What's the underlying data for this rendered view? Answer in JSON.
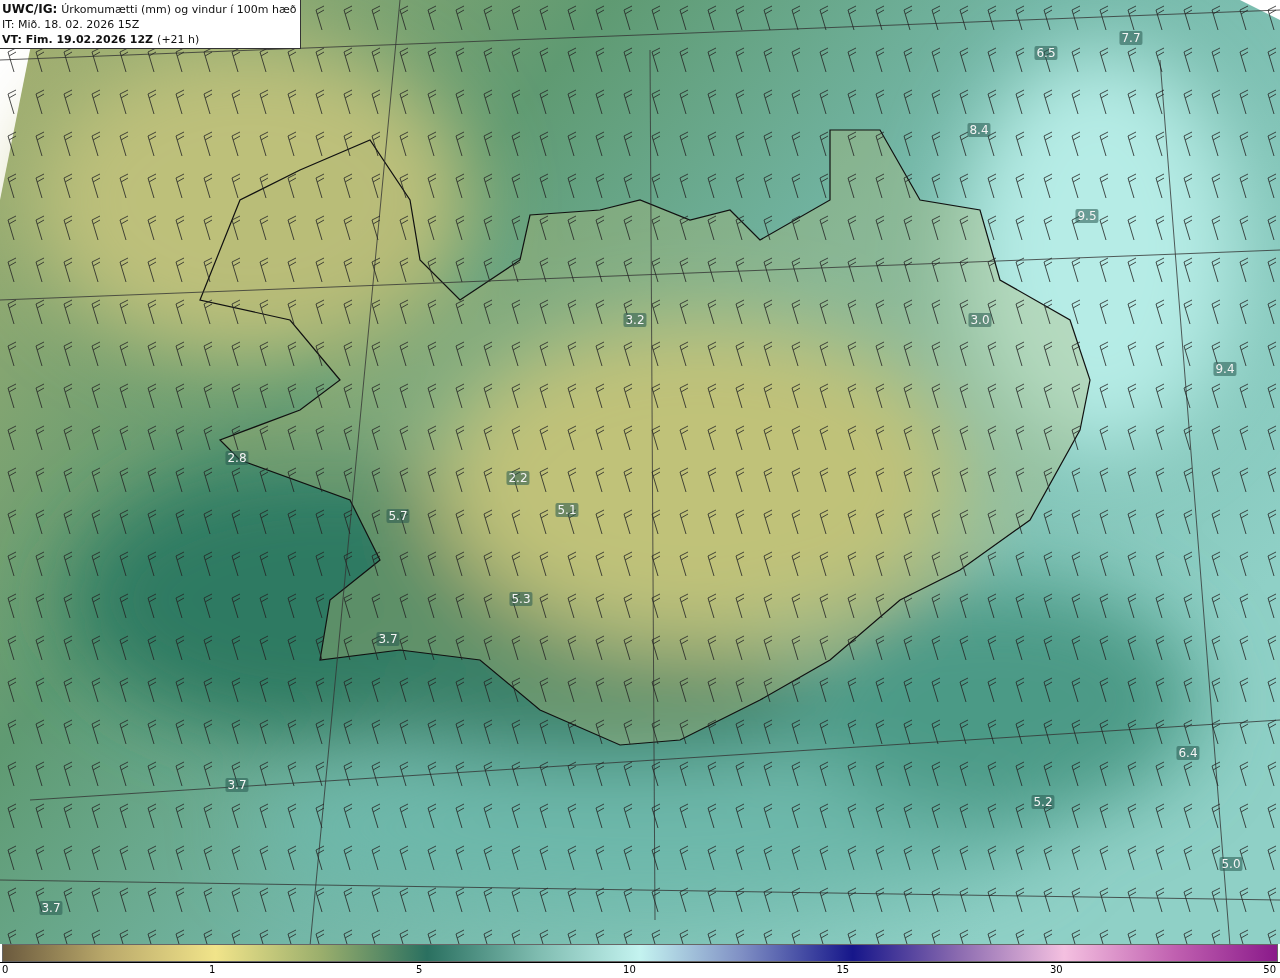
{
  "title_box": {
    "product": "UWC/IG:",
    "description": "Úrkomumætti (mm) og vindur í 100m hæð",
    "issue_time": "IT: Mið. 18. 02. 2026 15Z",
    "valid_label": "VT: Fim. 19.02.2026 12Z",
    "valid_offset": "(+21 h)"
  },
  "map_labels": [
    {
      "text": "6.5"
    },
    {
      "text": "7.7"
    },
    {
      "text": "8.4"
    },
    {
      "text": "9.5"
    },
    {
      "text": "3.2"
    },
    {
      "text": "3.0"
    },
    {
      "text": "9.4"
    },
    {
      "text": "2.8"
    },
    {
      "text": "2.2"
    },
    {
      "text": "5.7"
    },
    {
      "text": "5.1"
    },
    {
      "text": "5.3"
    },
    {
      "text": "3.7"
    },
    {
      "text": "6.4"
    },
    {
      "text": "3.7"
    },
    {
      "text": "5.2"
    },
    {
      "text": "5.0"
    },
    {
      "text": "3.7"
    }
  ],
  "legend": {
    "ticks": [
      "0",
      "1",
      "5",
      "10",
      "15",
      "30",
      "50"
    ]
  }
}
